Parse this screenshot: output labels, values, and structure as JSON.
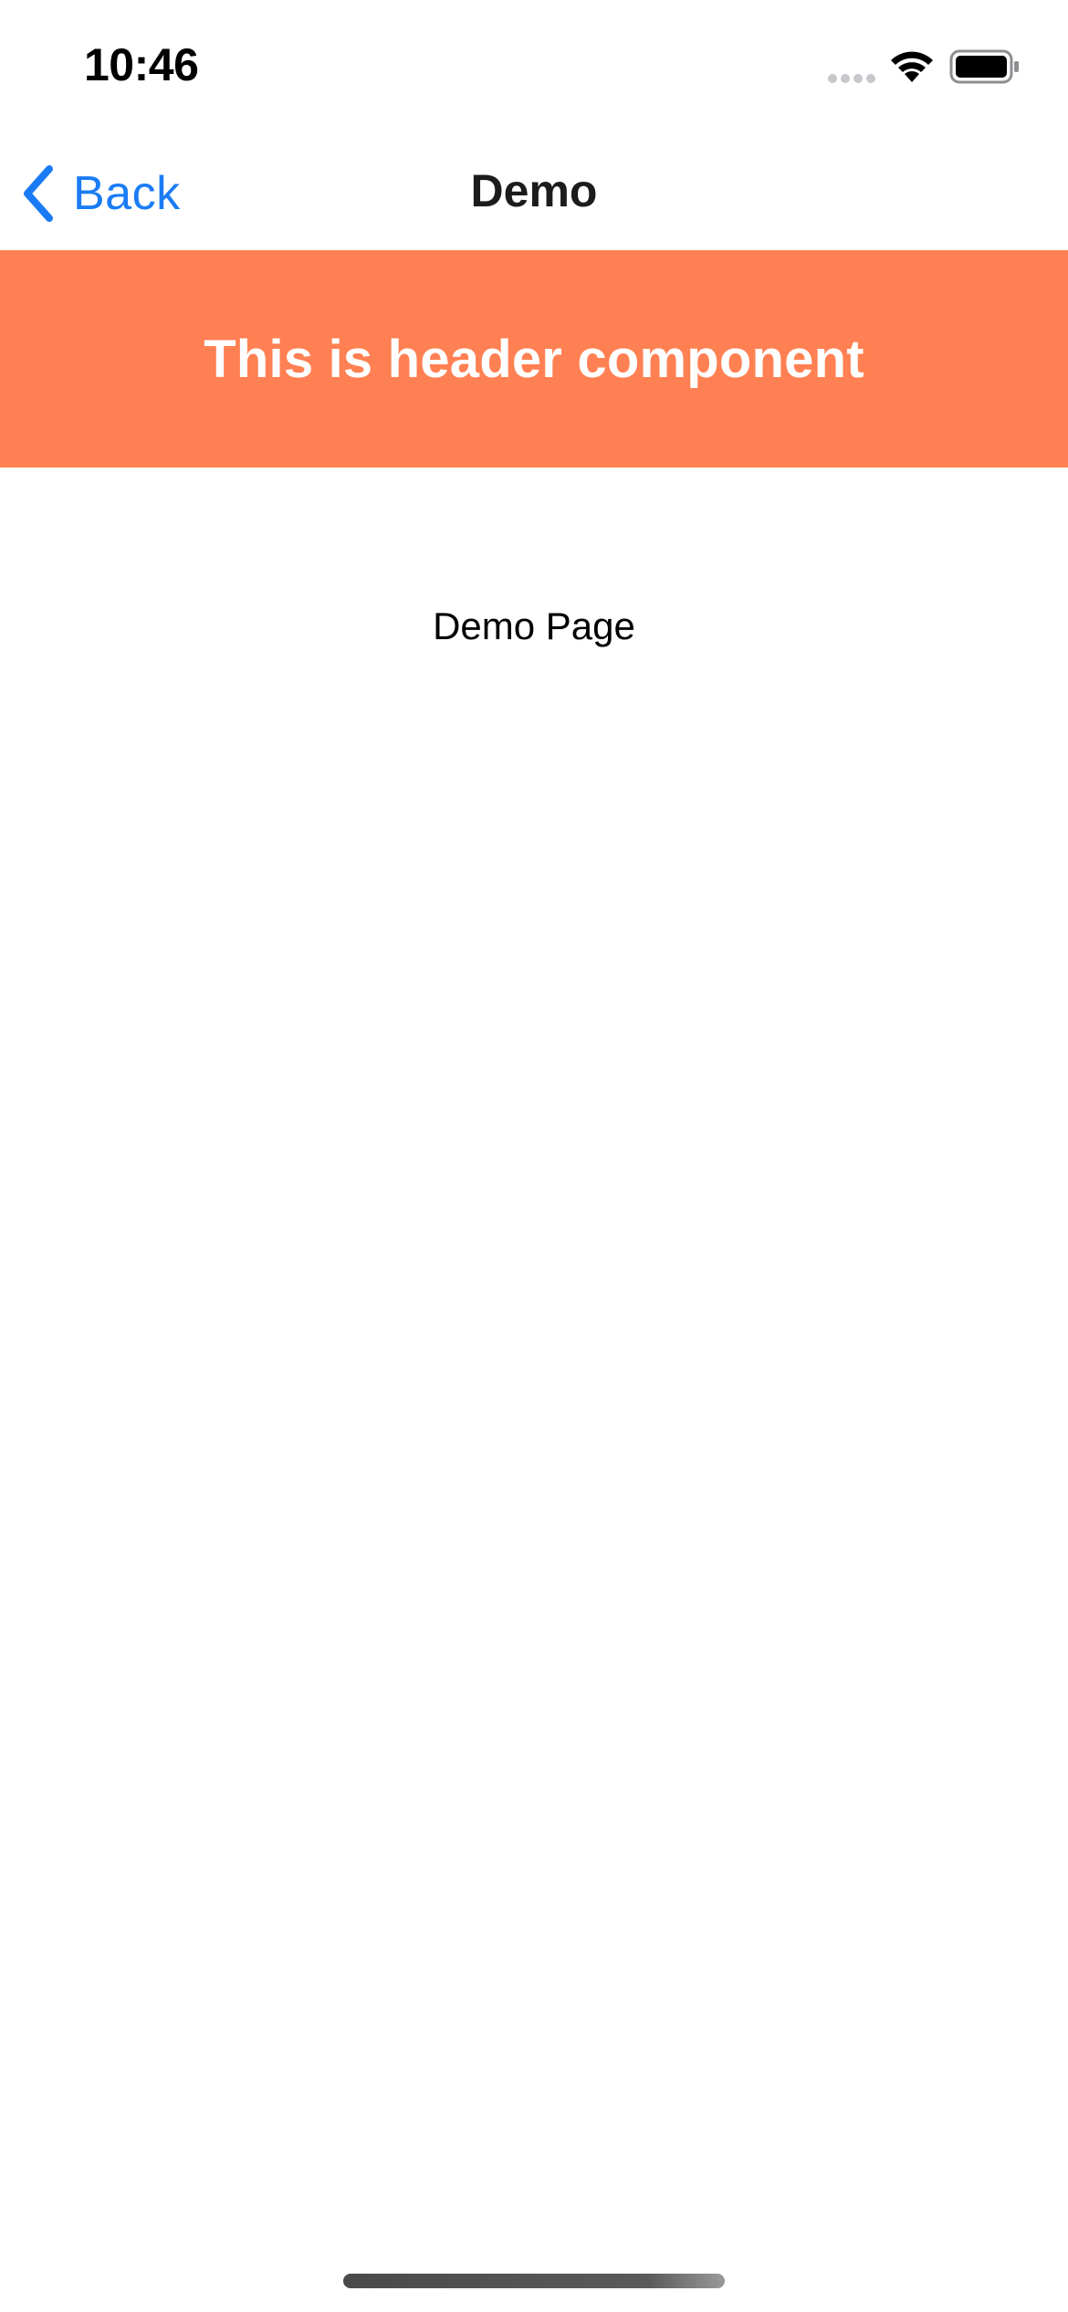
{
  "status_bar": {
    "time": "10:46",
    "icons": [
      "cellular-signal-icon",
      "wifi-icon",
      "battery-icon"
    ]
  },
  "nav_bar": {
    "back_label": "Back",
    "title": "Demo",
    "accent_color": "#1a7cf5"
  },
  "header_component": {
    "text": "This is header component",
    "background_color": "#ff8052",
    "text_color": "#ffffff"
  },
  "content": {
    "page_text": "Demo Page"
  }
}
